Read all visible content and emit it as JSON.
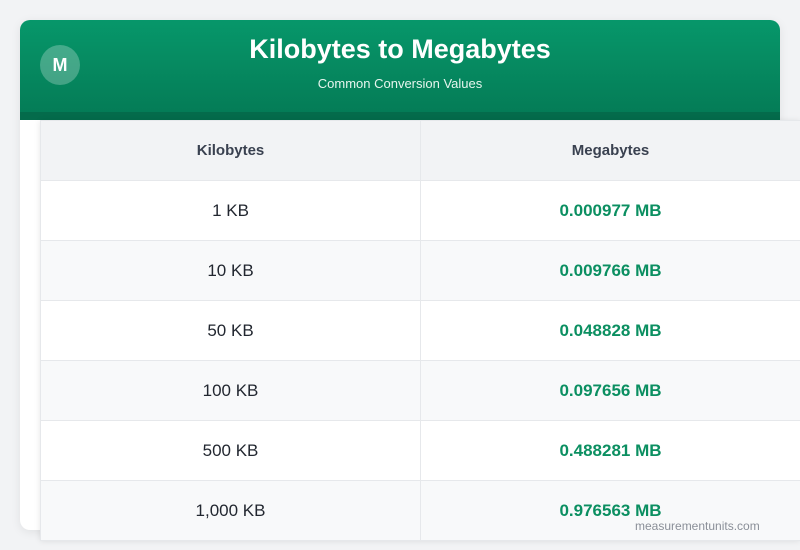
{
  "header": {
    "logo_letter": "M",
    "title": "Kilobytes to Megabytes",
    "subtitle": "Common Conversion Values"
  },
  "table": {
    "columns": [
      "Kilobytes",
      "Megabytes"
    ],
    "rows": [
      {
        "kb": "1 KB",
        "mb": "0.000977 MB"
      },
      {
        "kb": "10 KB",
        "mb": "0.009766 MB"
      },
      {
        "kb": "50 KB",
        "mb": "0.048828 MB"
      },
      {
        "kb": "100 KB",
        "mb": "0.097656 MB"
      },
      {
        "kb": "500 KB",
        "mb": "0.488281 MB"
      },
      {
        "kb": "1,000 KB",
        "mb": "0.976563 MB"
      }
    ]
  },
  "footer": {
    "watermark": "measurementunits.com"
  },
  "colors": {
    "brand_green": "#07976a",
    "value_green": "#0b8f61",
    "background": "#f2f3f5"
  }
}
